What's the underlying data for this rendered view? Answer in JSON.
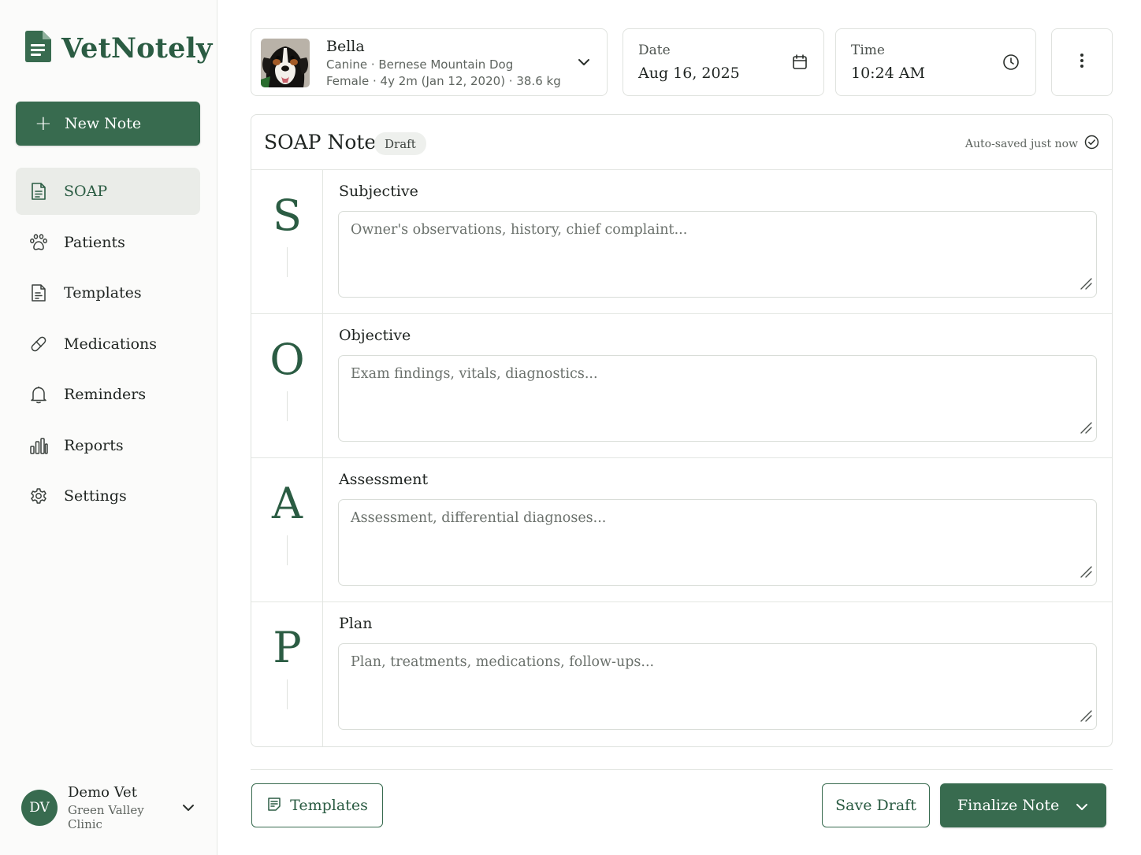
{
  "app": {
    "name": "VetNotely"
  },
  "colors": {
    "accent": "#386b4f",
    "accent_text": "#2b5c43",
    "nav_active_bg": "#eaece8"
  },
  "sidebar": {
    "new_note_label": "New Note",
    "items": [
      {
        "label": "SOAP",
        "icon": "document-icon",
        "active": true
      },
      {
        "label": "Patients",
        "icon": "paw-icon"
      },
      {
        "label": "Templates",
        "icon": "template-icon"
      },
      {
        "label": "Medications",
        "icon": "pill-icon"
      },
      {
        "label": "Reminders",
        "icon": "bell-icon"
      },
      {
        "label": "Reports",
        "icon": "bar-chart-icon"
      },
      {
        "label": "Settings",
        "icon": "gear-icon"
      }
    ],
    "user": {
      "initials": "DV",
      "name": "Demo Vet",
      "clinic": "Green Valley Clinic"
    }
  },
  "patient": {
    "name": "Bella",
    "line1": "Canine · Bernese Mountain Dog",
    "line2": "Female · 4y 2m (Jan 12, 2020) · 38.6 kg"
  },
  "date": {
    "label": "Date",
    "value": "Aug 16, 2025"
  },
  "time": {
    "label": "Time",
    "value": "10:24 AM"
  },
  "soap": {
    "title": "SOAP Note",
    "status": "Draft",
    "autosave": "Auto-saved just now",
    "sections": [
      {
        "letter": "S",
        "title": "Subjective",
        "placeholder": "Owner's observations, history, chief complaint..."
      },
      {
        "letter": "O",
        "title": "Objective",
        "placeholder": "Exam findings, vitals, diagnostics..."
      },
      {
        "letter": "A",
        "title": "Assessment",
        "placeholder": "Assessment, differential diagnoses..."
      },
      {
        "letter": "P",
        "title": "Plan",
        "placeholder": "Plan, treatments, medications, follow-ups..."
      }
    ]
  },
  "footer": {
    "templates_label": "Templates",
    "save_draft_label": "Save Draft",
    "finalize_label": "Finalize Note"
  }
}
